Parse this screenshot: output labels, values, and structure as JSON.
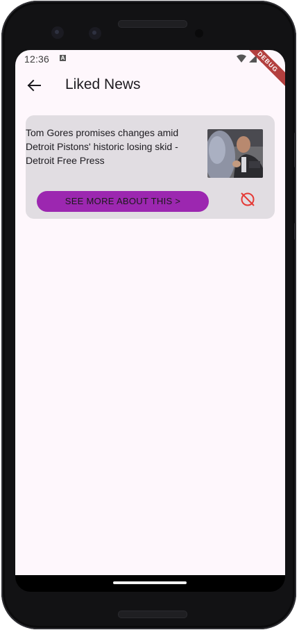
{
  "status_bar": {
    "time": "12:36",
    "notification_letter": "A",
    "debug_label": "DEBUG"
  },
  "app_bar": {
    "title": "Liked News",
    "back_icon": "arrow-left-icon"
  },
  "news": [
    {
      "title": "Tom Gores promises changes amid Detroit Pistons' historic losing skid - Detroit Free Press",
      "button_label": "SEE MORE ABOUT THIS >",
      "unlike_icon": "cancel-circle-icon"
    }
  ],
  "colors": {
    "screen_bg": "#fef7fc",
    "card_bg": "#e1dde2",
    "button_bg": "#9c27b0",
    "unlike_icon": "#e53935",
    "ribbon": "#b3403f"
  }
}
